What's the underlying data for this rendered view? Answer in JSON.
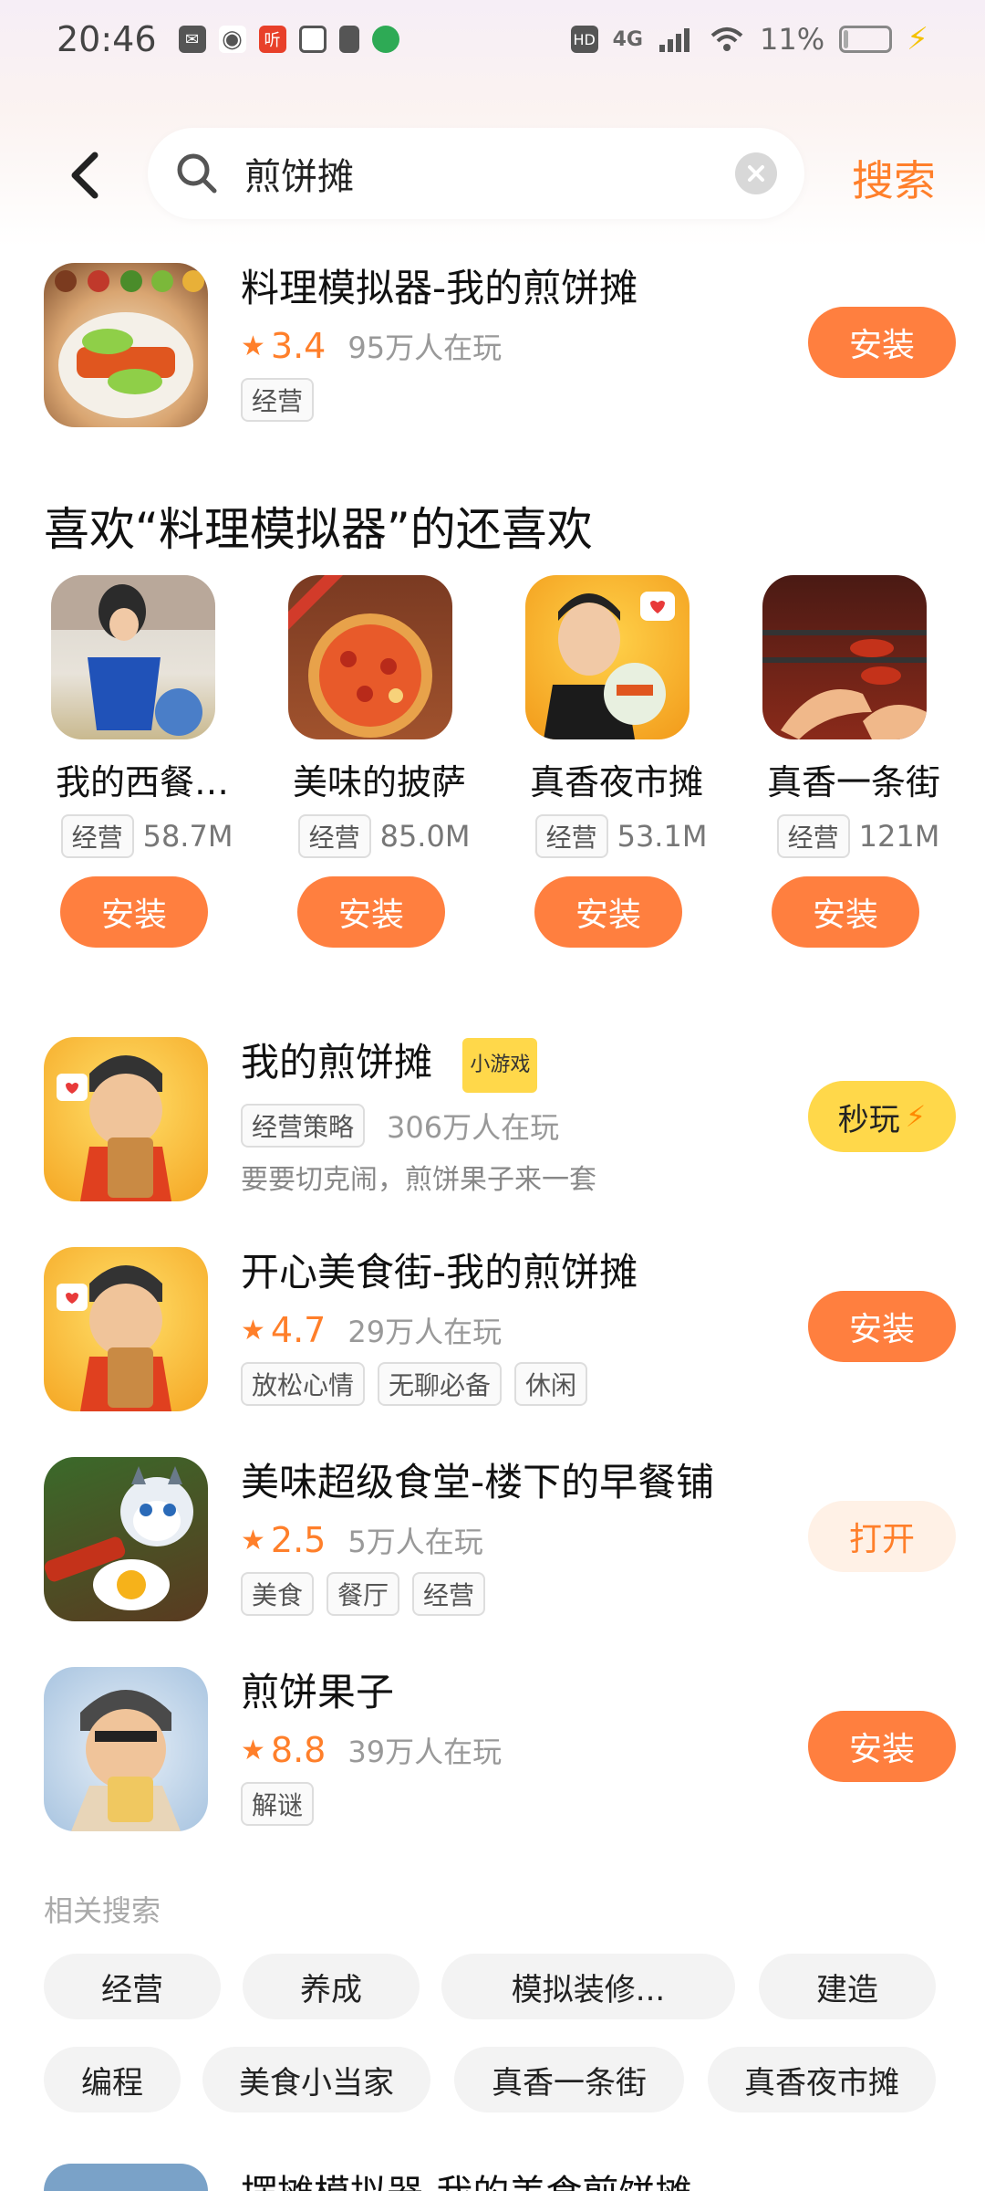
{
  "status_bar": {
    "time": "20:46",
    "network": "4G",
    "battery_percent": "11%",
    "battery_level": 0.11
  },
  "search": {
    "query": "煎饼摊",
    "submit_label": "搜索"
  },
  "top_result": {
    "title": "料理模拟器-我的煎饼摊",
    "rating": "3.4",
    "players": "95万人在玩",
    "tags": [
      "经营"
    ],
    "button": "安装"
  },
  "section": {
    "title": "喜欢“料理模拟器”的还喜欢"
  },
  "recommendations": [
    {
      "name": "我的西餐…",
      "tag": "经营",
      "size": "58.7M",
      "button": "安装"
    },
    {
      "name": "美味的披萨",
      "tag": "经营",
      "size": "85.0M",
      "button": "安装"
    },
    {
      "name": "真香夜市摊",
      "tag": "经营",
      "size": "53.1M",
      "button": "安装"
    },
    {
      "name": "真香一条街",
      "tag": "经营",
      "size": "121M",
      "button": "安装"
    }
  ],
  "results": [
    {
      "title": "我的煎饼摊",
      "badge": "小游戏",
      "tags": [
        "经营策略"
      ],
      "players": "306万人在玩",
      "desc": "要要切克闹，煎饼果子来一套",
      "button": "秒玩"
    },
    {
      "title": "开心美食街-我的煎饼摊",
      "rating": "4.7",
      "players": "29万人在玩",
      "tags": [
        "放松心情",
        "无聊必备",
        "休闲"
      ],
      "button": "安装"
    },
    {
      "title": "美味超级食堂-楼下的早餐铺",
      "rating": "2.5",
      "players": "5万人在玩",
      "tags": [
        "美食",
        "餐厅",
        "经营"
      ],
      "button": "打开"
    },
    {
      "title": "煎饼果子",
      "rating": "8.8",
      "players": "39万人在玩",
      "tags": [
        "解谜"
      ],
      "button": "安装"
    }
  ],
  "related": {
    "title": "相关搜索",
    "row1": [
      "经营",
      "养成",
      "模拟装修...",
      "建造"
    ],
    "row2": [
      "编程",
      "美食小当家",
      "真香一条街",
      "真香夜市摊"
    ]
  },
  "bottom_peek": {
    "title": "摆摊模拟器-我的美食煎饼摊"
  },
  "colors": {
    "accent": "#ff7f3f",
    "accent_text": "#ff7f2a",
    "mini_play": "#ffd84a"
  }
}
